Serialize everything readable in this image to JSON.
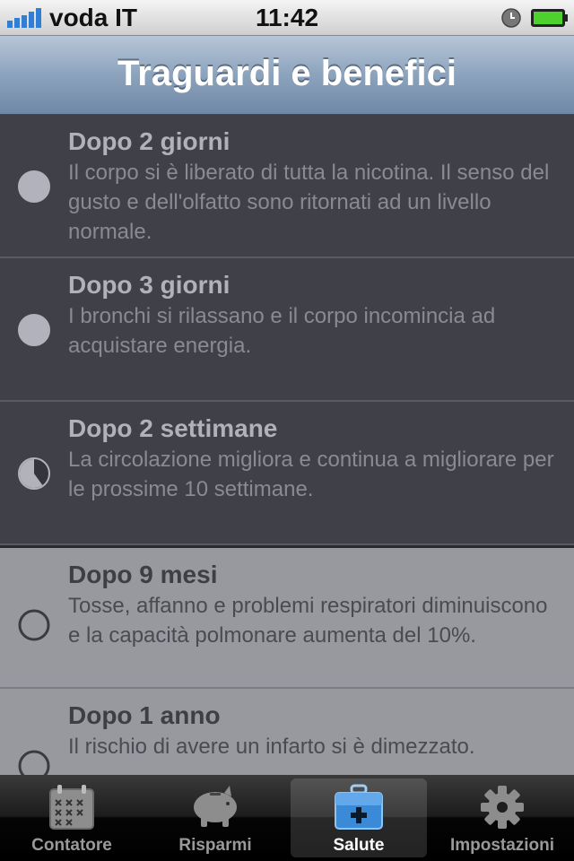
{
  "status_bar": {
    "carrier": "voda IT",
    "time": "11:42"
  },
  "nav": {
    "title": "Traguardi e benefici"
  },
  "milestones": [
    {
      "title": "Dopo 2 giorni",
      "description": "Il corpo si è liberato di tutta la nicotina. Il senso del gusto e dell'olfatto sono ritornati ad un livello normale.",
      "status": "reached",
      "progress": 1.0
    },
    {
      "title": "Dopo 3 giorni",
      "description": "I bronchi si rilassano e il corpo incomincia ad acquistare energia.",
      "status": "reached",
      "progress": 1.0
    },
    {
      "title": "Dopo 2 settimane",
      "description": "La circolazione migliora e continua a migliorare per le prossime 10 settimane.",
      "status": "reached",
      "progress": 0.4
    },
    {
      "title": "Dopo 9 mesi",
      "description": "Tosse, affanno e problemi respiratori diminuiscono e la capacità polmonare aumenta del 10%.",
      "status": "pending",
      "progress": 0.0
    },
    {
      "title": "Dopo 1 anno",
      "description": "Il rischio di avere un infarto si è dimezzato.",
      "status": "pending",
      "progress": 0.0
    }
  ],
  "tab_bar": {
    "tabs": [
      {
        "label": "Contatore",
        "icon": "calendar-icon",
        "selected": false
      },
      {
        "label": "Risparmi",
        "icon": "piggy-bank-icon",
        "selected": false
      },
      {
        "label": "Salute",
        "icon": "first-aid-kit-icon",
        "selected": true
      },
      {
        "label": "Impostazioni",
        "icon": "gear-icon",
        "selected": false
      }
    ]
  },
  "colors": {
    "reached_row": "#404049",
    "pending_row": "#98989f",
    "selected_tab_icon": "#3a8ad8",
    "battery": "#4cd12d",
    "signal": "#2f7fd6"
  }
}
